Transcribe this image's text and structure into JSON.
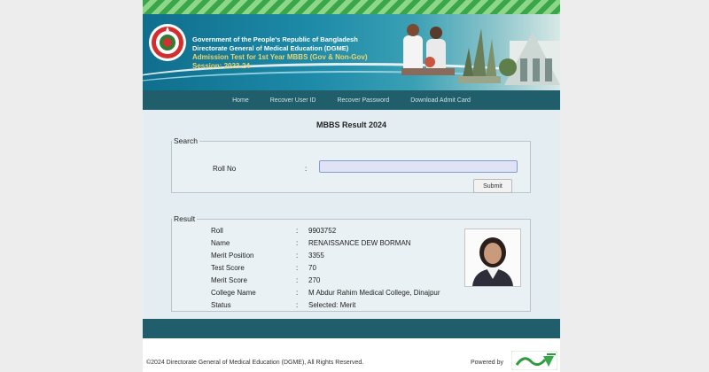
{
  "header": {
    "line1": "Government of the People's Republic of Bangladesh",
    "line2": "Directorate General of Medical Education (DGME)",
    "line3": "Admission Test for 1st Year MBBS (Gov & Non-Gov)",
    "line4": "Session: 2023-24"
  },
  "nav": {
    "items": [
      "Home",
      "Recover User ID",
      "Recover Password",
      "Download Admit Card"
    ]
  },
  "page_title": "MBBS Result 2024",
  "search": {
    "legend": "Search",
    "roll_label": "Roll No",
    "colon": ":",
    "roll_value": "",
    "submit_label": "Submit"
  },
  "result": {
    "legend": "Result",
    "rows": [
      {
        "label": "Roll",
        "value": "9903752"
      },
      {
        "label": "Name",
        "value": "RENAISSANCE DEW BORMAN"
      },
      {
        "label": "Merit Position",
        "value": "3355"
      },
      {
        "label": "Test Score",
        "value": "70"
      },
      {
        "label": "Merit Score",
        "value": "270"
      },
      {
        "label": "College Name",
        "value": "M Abdur Rahim Medical College, Dinajpur"
      },
      {
        "label": "Status",
        "value": "Selected: Merit"
      }
    ]
  },
  "footer": {
    "copyright": "©2024 Directorate General of Medical Education (DGME), All Rights Reserved.",
    "powered_by": "Powered by"
  },
  "colors": {
    "nav_bg": "#1f5e6a",
    "content_bg": "#e4eef2",
    "banner_teal": "#0f6e8d",
    "accent_green": "#3aa64a",
    "seal_red": "#d32f2f"
  },
  "icons": {
    "govt_seal": "bangladesh-govt-seal-icon",
    "teletalk": "teletalk-logo-icon"
  }
}
